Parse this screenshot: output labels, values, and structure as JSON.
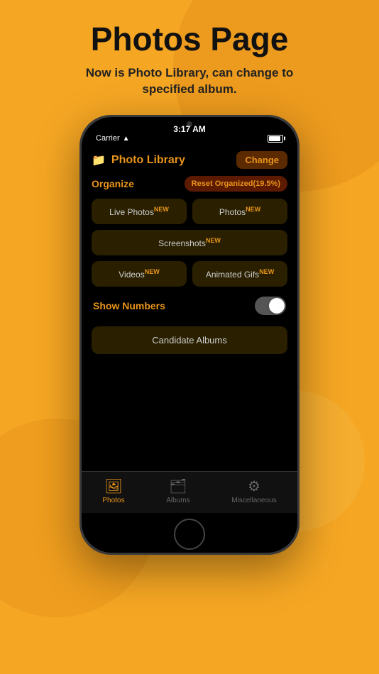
{
  "page": {
    "title": "Photos Page",
    "subtitle": "Now is Photo Library, can change to specified album."
  },
  "status_bar": {
    "carrier": "Carrier",
    "wifi": "📶",
    "time": "3:17 AM"
  },
  "header": {
    "title": "Photo Library",
    "change_label": "Change"
  },
  "organize": {
    "label": "Organize",
    "reset_label": "Reset Organized(19.5%)"
  },
  "categories": {
    "live_photos": "Live Photos",
    "photos": "Photos",
    "screenshots": "Screenshots",
    "videos": "Videos",
    "animated_gifs": "Animated Gifs",
    "new_badge": "NEW"
  },
  "show_numbers": {
    "label": "Show Numbers"
  },
  "candidate_albums": {
    "label": "Candidate Albums"
  },
  "tab_bar": {
    "photos": "Photos",
    "albums": "Albums",
    "miscellaneous": "Miscellaneous"
  }
}
